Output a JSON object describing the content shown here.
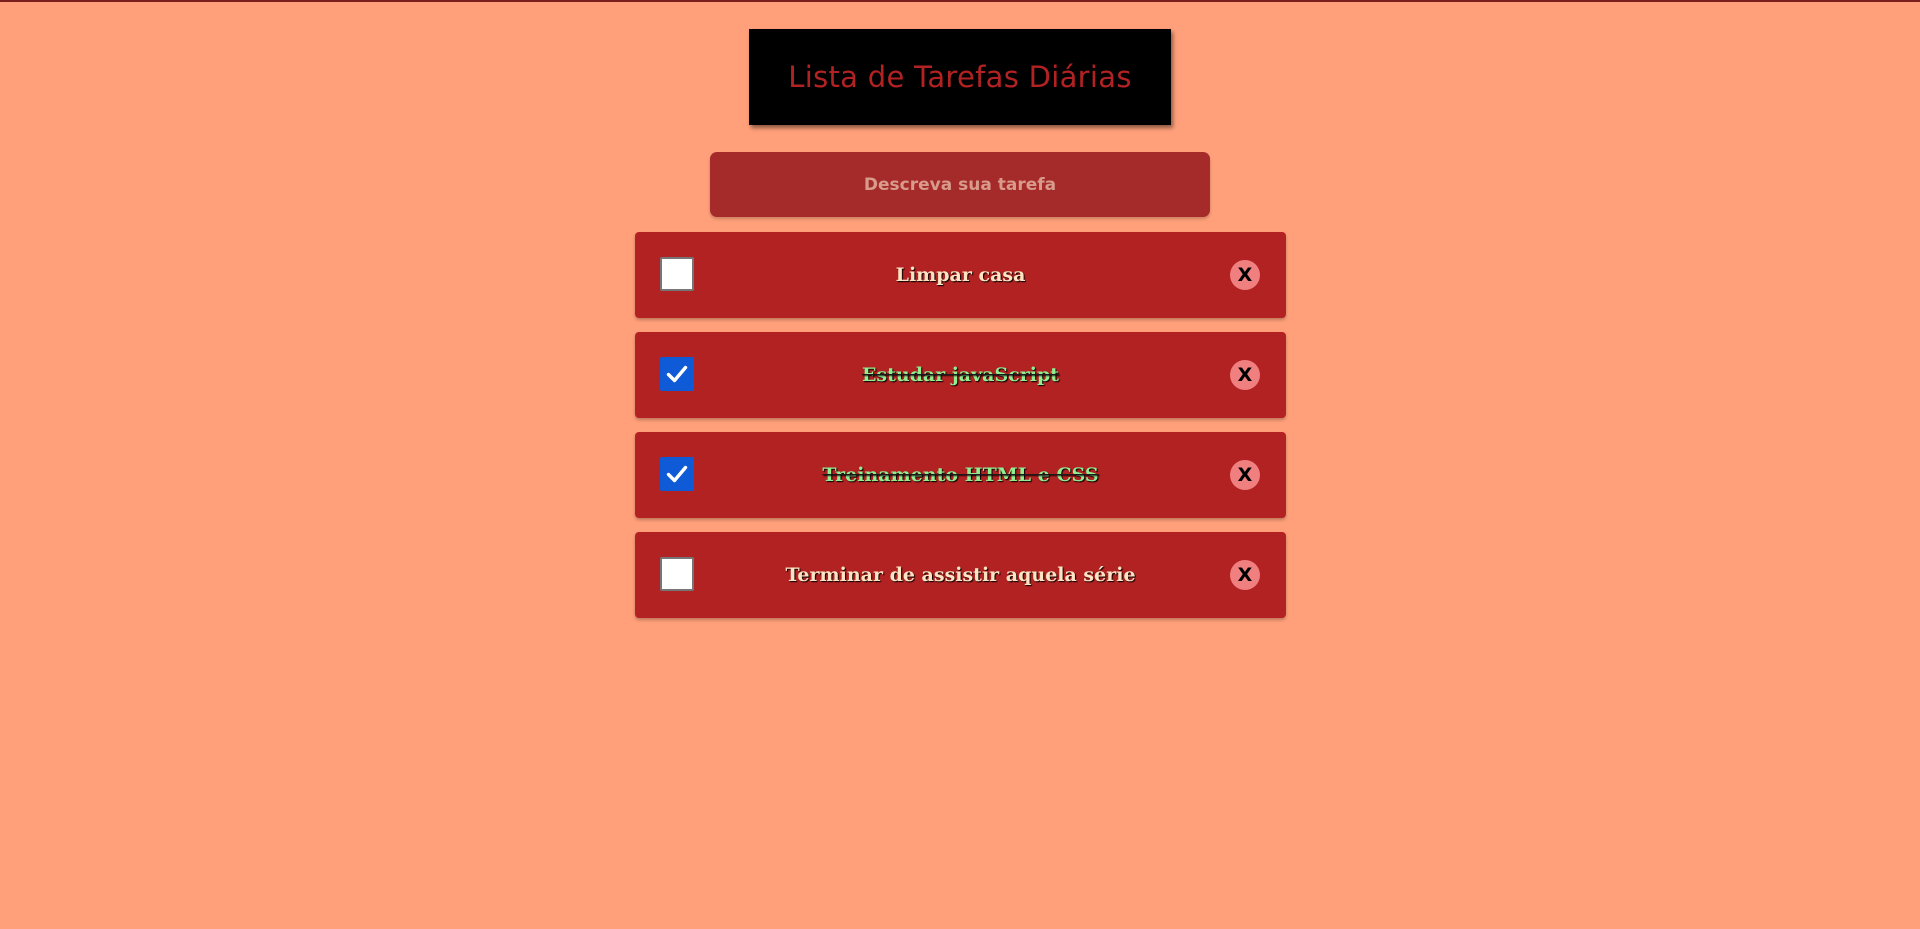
{
  "header": {
    "title": "Lista de Tarefas Diárias"
  },
  "input": {
    "placeholder": "Descreva sua tarefa",
    "value": ""
  },
  "tasks": [
    {
      "text": "Limpar casa",
      "done": false,
      "delete_label": "X"
    },
    {
      "text": "Estudar javaScript",
      "done": true,
      "delete_label": "X"
    },
    {
      "text": "Treinamento HTML e CSS",
      "done": true,
      "delete_label": "X"
    },
    {
      "text": "Terminar de assistir aquela série",
      "done": false,
      "delete_label": "X"
    }
  ],
  "icons": {
    "checkbox_checked": "checkmark-icon",
    "delete": "close-icon"
  },
  "colors": {
    "background": "#ffa07a",
    "title_box": "#000000",
    "title_text": "#b22222",
    "input_bg": "#a52a2a",
    "task_bg": "#b22222",
    "task_text": "#ffe4c4",
    "task_done_text": "#90ee90",
    "checkbox_checked": "#0f5ad6",
    "delete_button": "#f08080"
  }
}
